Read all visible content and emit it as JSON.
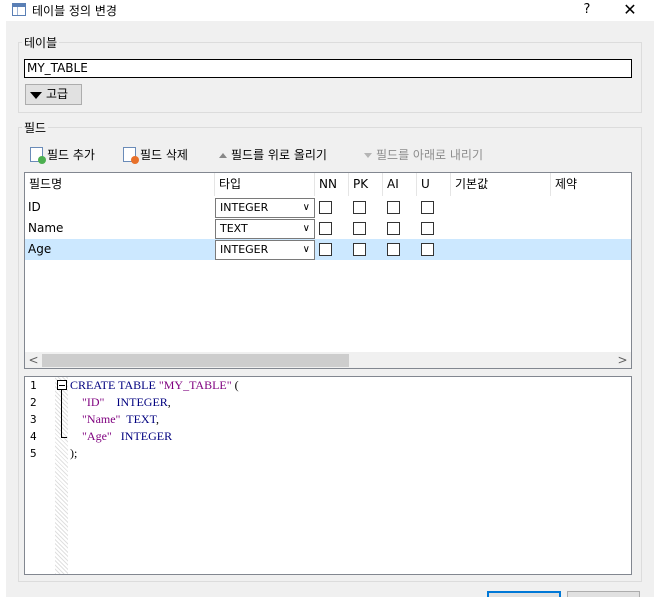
{
  "window": {
    "title": "테이블 정의 변경",
    "help_label": "?",
    "close_label": "✕"
  },
  "table_section": {
    "label": "테이블",
    "table_name": "MY_TABLE",
    "advanced_label": "고급"
  },
  "fields_section": {
    "label": "필드",
    "toolbar": {
      "add_field": "필드 추가",
      "delete_field": "필드 삭제",
      "move_up": "필드를 위로 올리기",
      "move_down": "필드를 아래로 내리기"
    },
    "columns": [
      "필드명",
      "타입",
      "NN",
      "PK",
      "AI",
      "U",
      "기본값",
      "제약"
    ],
    "rows": [
      {
        "name": "ID",
        "type": "INTEGER",
        "nn": false,
        "pk": false,
        "ai": false,
        "u": false,
        "selected": false
      },
      {
        "name": "Name",
        "type": "TEXT",
        "nn": false,
        "pk": false,
        "ai": false,
        "u": false,
        "selected": false
      },
      {
        "name": "Age",
        "type": "INTEGER",
        "nn": false,
        "pk": false,
        "ai": false,
        "u": false,
        "selected": true
      }
    ],
    "scroll_left": "<",
    "scroll_right": ">"
  },
  "sql_preview": {
    "line_numbers": [
      "1",
      "2",
      "3",
      "4",
      "5"
    ],
    "lines": [
      [
        {
          "t": "CREATE TABLE ",
          "c": "kw"
        },
        {
          "t": "\"MY_TABLE\"",
          "c": "str"
        },
        {
          "t": " (",
          "c": "plain"
        }
      ],
      [
        {
          "t": "    \"ID\"",
          "c": "str"
        },
        {
          "t": "    INTEGER",
          "c": "kw"
        },
        {
          "t": ",",
          "c": "plain"
        }
      ],
      [
        {
          "t": "    \"Name\"",
          "c": "str"
        },
        {
          "t": "  TEXT",
          "c": "kw"
        },
        {
          "t": ",",
          "c": "plain"
        }
      ],
      [
        {
          "t": "    \"Age\"",
          "c": "str"
        },
        {
          "t": "   INTEGER",
          "c": "kw"
        }
      ],
      [
        {
          "t": ");",
          "c": "plain"
        }
      ]
    ]
  },
  "colors": {
    "selection": "#cce8ff",
    "keyword": "#00007f",
    "string": "#7f007f",
    "add_icon_accent": "#4caf50",
    "delete_icon_accent": "#e8712b"
  },
  "icons": {
    "title": "table-icon",
    "add": "add-field-icon",
    "delete": "delete-field-icon",
    "up": "arrow-up-icon",
    "down": "arrow-down-icon",
    "advanced": "triangle-down-icon"
  }
}
